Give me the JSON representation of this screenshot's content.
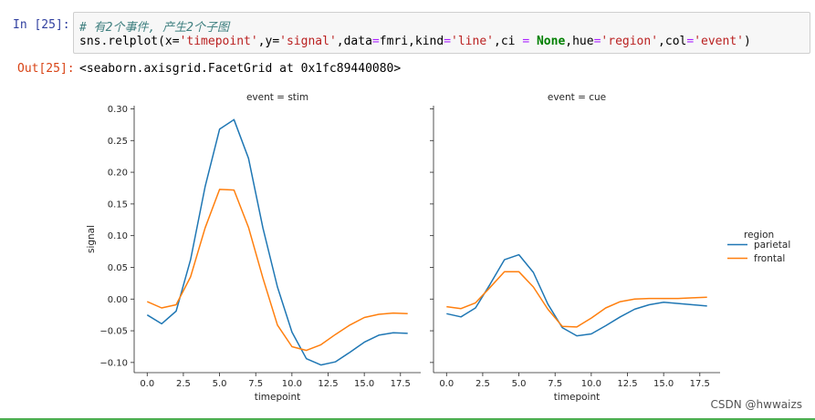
{
  "notebook": {
    "in_prompt": "In  [25]:",
    "out_prompt": "Out[25]:",
    "code_comment": "# 有2个事件, 产生2个子图",
    "code_line": {
      "p1": "sns.relplot(x=",
      "s1": "'timepoint'",
      "p2": ",y=",
      "s2": "'signal'",
      "p3": ",data",
      "o1": "=",
      "p4": "fmri,kind",
      "o2": "=",
      "s3": "'line'",
      "p5": ",ci ",
      "o3": "=",
      "p6": " ",
      "k1": "None",
      "p7": ",hue",
      "o4": "=",
      "s4": "'region'",
      "p8": ",col",
      "o5": "=",
      "s5": "'event'",
      "p9": ")"
    },
    "output_text": "<seaborn.axisgrid.FacetGrid at 0x1fc89440080>"
  },
  "watermark": "CSDN @hwwaizs",
  "colors": {
    "parietal": "#1f77b4",
    "frontal": "#ff7f0e"
  },
  "chart_data": [
    {
      "type": "line",
      "title": "event = stim",
      "xlabel": "timepoint",
      "ylabel": "signal",
      "xlim": [
        -0.9,
        18.9
      ],
      "ylim": [
        -0.116,
        0.305
      ],
      "xticks": [
        "0.0",
        "2.5",
        "5.0",
        "7.5",
        "10.0",
        "12.5",
        "15.0",
        "17.5"
      ],
      "yticks": [
        "0.30",
        "0.25",
        "0.20",
        "0.15",
        "0.10",
        "0.05",
        "0.00",
        "−0.05",
        "−0.10"
      ],
      "x": [
        0,
        1,
        2,
        3,
        4,
        5,
        6,
        7,
        8,
        9,
        10,
        11,
        12,
        13,
        14,
        15,
        16,
        17,
        18
      ],
      "series": [
        {
          "name": "parietal",
          "values": [
            -0.025,
            -0.039,
            -0.019,
            0.062,
            0.177,
            0.268,
            0.283,
            0.222,
            0.112,
            0.019,
            -0.052,
            -0.094,
            -0.104,
            -0.099,
            -0.084,
            -0.068,
            -0.057,
            -0.053,
            -0.054
          ]
        },
        {
          "name": "frontal",
          "values": [
            -0.004,
            -0.014,
            -0.009,
            0.035,
            0.112,
            0.173,
            0.172,
            0.113,
            0.033,
            -0.041,
            -0.075,
            -0.081,
            -0.072,
            -0.056,
            -0.041,
            -0.029,
            -0.024,
            -0.022,
            -0.023
          ]
        }
      ]
    },
    {
      "type": "line",
      "title": "event = cue",
      "xlabel": "timepoint",
      "ylabel": "",
      "xlim": [
        -0.9,
        18.9
      ],
      "ylim": [
        -0.116,
        0.305
      ],
      "xticks": [
        "0.0",
        "2.5",
        "5.0",
        "7.5",
        "10.0",
        "12.5",
        "15.0",
        "17.5"
      ],
      "yticks": [],
      "x": [
        0,
        1,
        2,
        3,
        4,
        5,
        6,
        7,
        8,
        9,
        10,
        11,
        12,
        13,
        14,
        15,
        16,
        17,
        18
      ],
      "series": [
        {
          "name": "parietal",
          "values": [
            -0.023,
            -0.028,
            -0.014,
            0.023,
            0.062,
            0.07,
            0.042,
            -0.008,
            -0.045,
            -0.058,
            -0.055,
            -0.042,
            -0.028,
            -0.016,
            -0.009,
            -0.005,
            -0.007,
            -0.009,
            -0.011
          ]
        },
        {
          "name": "frontal",
          "values": [
            -0.012,
            -0.015,
            -0.006,
            0.018,
            0.043,
            0.043,
            0.019,
            -0.016,
            -0.043,
            -0.044,
            -0.03,
            -0.014,
            -0.004,
            0.0,
            0.001,
            0.001,
            0.001,
            0.002,
            0.003
          ]
        }
      ]
    }
  ],
  "legend": {
    "title": "region",
    "items": [
      "parietal",
      "frontal"
    ],
    "placement": "right"
  }
}
